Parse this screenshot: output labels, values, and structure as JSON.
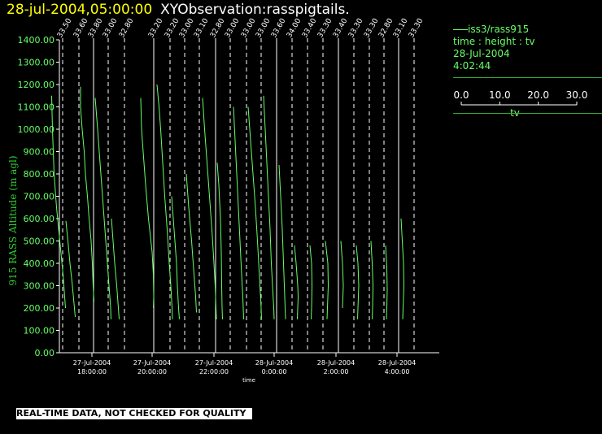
{
  "header": {
    "date_time": "28-jul-2004,05:00:00",
    "observation": "XYObservation:rasspigtails."
  },
  "legend": {
    "series": "iss3/rass915",
    "axes_desc": "time : height : tv",
    "date": "28-Jul-2004",
    "time": "4:02:44",
    "tv_ticks": [
      "0.0",
      "10.0",
      "20.0",
      "30.0"
    ],
    "tv_label": "tv"
  },
  "disclaimer": "REAL-TIME DATA, NOT CHECKED FOR QUALITY",
  "colors": {
    "trace": "#66ff66",
    "axis": "#ffffff",
    "ylabel": "#33cc33",
    "date": "#ffff00"
  },
  "chart_data": {
    "type": "line",
    "ylabel": "915 RASS Altitude (m agl)",
    "xlabel": "time",
    "ylim": [
      0,
      1400
    ],
    "y_ticks": [
      "0.00",
      "100.00",
      "200.00",
      "300.00",
      "400.00",
      "500.00",
      "600.00",
      "700.00",
      "800.00",
      "900.00",
      "1000.00",
      "1100.00",
      "1200.00",
      "1300.00",
      "1400.00"
    ],
    "x_ticks": [
      {
        "date": "27-Jul-2004",
        "time": "18:00:00"
      },
      {
        "date": "27-Jul-2004",
        "time": "20:00:00"
      },
      {
        "date": "27-Jul-2004",
        "time": "22:00:00"
      },
      {
        "date": "28-Jul-2004",
        "time": "0:00:00"
      },
      {
        "date": "28-Jul-2004",
        "time": "2:00:00"
      },
      {
        "date": "28-Jul-2004",
        "time": "4:00:00"
      }
    ],
    "profiles": [
      {
        "label": "33.50",
        "points": [
          [
            1150,
            2.5
          ],
          [
            1000,
            3.5
          ],
          [
            800,
            5.5
          ],
          [
            650,
            8.5
          ],
          [
            500,
            12.5
          ],
          [
            350,
            16.5
          ],
          [
            250,
            18.5
          ],
          [
            200,
            19.5
          ]
        ]
      },
      {
        "label": "33.60",
        "points": [
          [
            590,
            0
          ],
          [
            500,
            2.5
          ],
          [
            400,
            5
          ],
          [
            300,
            8
          ],
          [
            200,
            10.5
          ],
          [
            160,
            11.5
          ]
        ]
      },
      {
        "label": "33.80",
        "points": [
          [
            1190,
            0
          ],
          [
            1100,
            0
          ],
          [
            1000,
            2
          ],
          [
            900,
            4.5
          ],
          [
            800,
            6
          ],
          [
            700,
            8.5
          ],
          [
            600,
            10.5
          ],
          [
            500,
            13
          ],
          [
            400,
            14.5
          ],
          [
            300,
            15.5
          ],
          [
            230,
            16.5
          ]
        ]
      },
      {
        "label": "33.00",
        "points": [
          [
            1140,
            0
          ],
          [
            1000,
            3
          ],
          [
            850,
            6
          ],
          [
            700,
            9
          ],
          [
            550,
            12
          ],
          [
            400,
            15
          ],
          [
            300,
            17
          ],
          [
            200,
            19
          ],
          [
            150,
            19.5
          ]
        ]
      },
      {
        "label": "32.80",
        "points": [
          [
            600,
            0
          ],
          [
            500,
            2
          ],
          [
            400,
            4
          ],
          [
            300,
            6.5
          ],
          [
            200,
            8.5
          ],
          [
            150,
            9.5
          ]
        ]
      },
      {
        "label": "33.20",
        "points": [
          [
            1140,
            0
          ],
          [
            1000,
            1
          ],
          [
            900,
            3
          ],
          [
            750,
            6
          ],
          [
            600,
            9.5
          ],
          [
            450,
            14
          ],
          [
            350,
            15.5
          ],
          [
            250,
            16
          ],
          [
            200,
            15.5
          ]
        ]
      },
      {
        "label": "33.20",
        "points": [
          [
            1200,
            0
          ],
          [
            1100,
            2.5
          ],
          [
            1000,
            4.5
          ],
          [
            850,
            7
          ],
          [
            700,
            9.5
          ],
          [
            550,
            12.5
          ],
          [
            400,
            15
          ],
          [
            300,
            17
          ],
          [
            200,
            18.5
          ],
          [
            150,
            19
          ]
        ]
      },
      {
        "label": "33.00",
        "points": [
          [
            700,
            0
          ],
          [
            600,
            2
          ],
          [
            500,
            4
          ],
          [
            400,
            6
          ],
          [
            300,
            7
          ],
          [
            200,
            8.5
          ],
          [
            150,
            9.5
          ]
        ]
      },
      {
        "label": "33.10",
        "points": [
          [
            800,
            0
          ],
          [
            650,
            3
          ],
          [
            500,
            6.5
          ],
          [
            350,
            9.5
          ],
          [
            250,
            11.5
          ],
          [
            180,
            12.5
          ]
        ]
      },
      {
        "label": "32.80",
        "points": [
          [
            1140,
            0
          ],
          [
            1000,
            2.5
          ],
          [
            850,
            5.5
          ],
          [
            700,
            8.5
          ],
          [
            550,
            11.5
          ],
          [
            400,
            14
          ],
          [
            300,
            15.5
          ],
          [
            200,
            16.5
          ],
          [
            150,
            17
          ]
        ]
      },
      {
        "label": "33.00",
        "points": [
          [
            850,
            0
          ],
          [
            750,
            2
          ],
          [
            600,
            4
          ],
          [
            450,
            5
          ],
          [
            300,
            5.5
          ],
          [
            200,
            6
          ],
          [
            150,
            6.5
          ]
        ]
      },
      {
        "label": "33.00",
        "points": [
          [
            1100,
            0
          ],
          [
            950,
            2
          ],
          [
            800,
            4
          ],
          [
            650,
            6
          ],
          [
            500,
            8
          ],
          [
            350,
            10
          ],
          [
            250,
            11.5
          ],
          [
            150,
            12.5
          ]
        ]
      },
      {
        "label": "33.00",
        "points": [
          [
            1100,
            0
          ],
          [
            950,
            3
          ],
          [
            800,
            6
          ],
          [
            650,
            9
          ],
          [
            500,
            11.5
          ],
          [
            400,
            13
          ],
          [
            300,
            14.5
          ],
          [
            200,
            16
          ],
          [
            150,
            16.5
          ]
        ]
      },
      {
        "label": "33.60",
        "points": [
          [
            1150,
            0
          ],
          [
            1000,
            2
          ],
          [
            850,
            4
          ],
          [
            700,
            6
          ],
          [
            550,
            8
          ],
          [
            400,
            9.5
          ],
          [
            300,
            11
          ],
          [
            200,
            12.5
          ],
          [
            150,
            13
          ]
        ]
      },
      {
        "label": "34.00",
        "points": [
          [
            840,
            0
          ],
          [
            700,
            2
          ],
          [
            550,
            4
          ],
          [
            400,
            5.5
          ],
          [
            300,
            6.5
          ],
          [
            200,
            7.5
          ],
          [
            150,
            8
          ]
        ]
      },
      {
        "label": "33.40",
        "points": [
          [
            480,
            0
          ],
          [
            400,
            2
          ],
          [
            300,
            4
          ],
          [
            250,
            4.5
          ],
          [
            200,
            4
          ],
          [
            150,
            3.5
          ]
        ]
      },
      {
        "label": "33.30",
        "points": [
          [
            480,
            0
          ],
          [
            400,
            2
          ],
          [
            300,
            2.5
          ],
          [
            200,
            2
          ],
          [
            150,
            1.5
          ]
        ]
      },
      {
        "label": "33.40",
        "points": [
          [
            500,
            0
          ],
          [
            400,
            3
          ],
          [
            300,
            3.5
          ],
          [
            200,
            2.5
          ],
          [
            150,
            2
          ]
        ]
      },
      {
        "label": "33.30",
        "points": [
          [
            500,
            0
          ],
          [
            400,
            2
          ],
          [
            300,
            3
          ],
          [
            250,
            2.5
          ],
          [
            200,
            2
          ]
        ]
      },
      {
        "label": "33.30",
        "points": [
          [
            480,
            0
          ],
          [
            400,
            2
          ],
          [
            300,
            3
          ],
          [
            200,
            2
          ],
          [
            150,
            1.5
          ]
        ]
      },
      {
        "label": "32.80",
        "points": [
          [
            500,
            0
          ],
          [
            400,
            1.5
          ],
          [
            300,
            2.5
          ],
          [
            200,
            2
          ],
          [
            150,
            1.5
          ]
        ]
      },
      {
        "label": "33.10",
        "points": [
          [
            480,
            0
          ],
          [
            380,
            1.5
          ],
          [
            280,
            2
          ],
          [
            200,
            1.5
          ],
          [
            150,
            1
          ]
        ]
      },
      {
        "label": "33.30",
        "points": [
          [
            600,
            0
          ],
          [
            500,
            1.5
          ],
          [
            400,
            3
          ],
          [
            300,
            3.5
          ],
          [
            200,
            2.5
          ],
          [
            150,
            2
          ]
        ]
      }
    ]
  }
}
